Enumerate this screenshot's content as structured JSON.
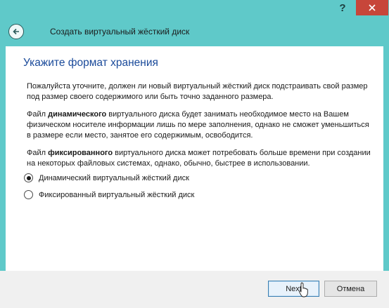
{
  "titlebar": {
    "help_label": "?",
    "close_icon": "close-icon"
  },
  "header": {
    "back_icon": "back-arrow-icon",
    "title": "Создать виртуальный жёсткий диск"
  },
  "content": {
    "section_title": "Укажите формат хранения",
    "paragraph1": "Пожалуйста уточните, должен ли новый виртуальный жёсткий диск подстраивать свой размер под размер своего содержимого или быть точно заданного размера.",
    "paragraph2": {
      "before": "Файл ",
      "bold": "динамического",
      "after": " виртуального диска будет занимать необходимое место на Вашем физическом носителе информации лишь по мере заполнения, однако не сможет уменьшиться в размере если место, занятое его содержимым, освободится."
    },
    "paragraph3": {
      "before": "Файл ",
      "bold": "фиксированного",
      "after": " виртуального диска может потребовать больше времени при создании на некоторых файловых системах, однако, обычно, быстрее в использовании."
    },
    "options": [
      {
        "label": "Динамический виртуальный жёсткий диск",
        "selected": true
      },
      {
        "label": "Фиксированный виртуальный жёсткий диск",
        "selected": false
      }
    ]
  },
  "footer": {
    "next_label": "Next",
    "cancel_label": "Отмена"
  },
  "colors": {
    "frame": "#5fc9c9",
    "close_button": "#c7463a",
    "section_title": "#1a4a9a"
  }
}
